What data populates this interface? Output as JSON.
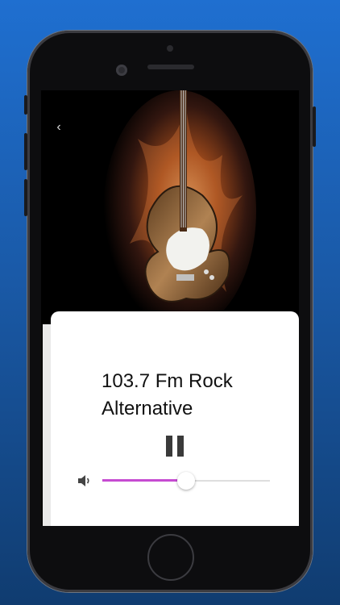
{
  "colors": {
    "background_top": "#1f6fd0",
    "background_bottom": "#103c70",
    "slider_fill": "#c64bd1",
    "pause_icon": "#3a3a3a"
  },
  "player": {
    "back_icon": "chevron-left-icon",
    "station_line1": "103.7 Fm Rock",
    "station_line2": "Alternative",
    "pause_icon": "pause-icon",
    "volume_icon": "speaker-icon",
    "volume_level": 0.5
  }
}
